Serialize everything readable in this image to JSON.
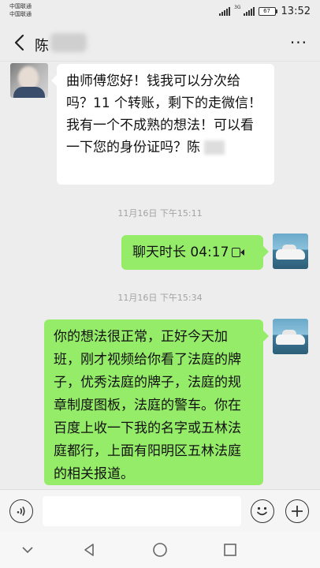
{
  "status_bar": {
    "carrier_1": "中国联通",
    "carrier_2": "中国联通",
    "network_label": "3G",
    "battery": "67",
    "time": "13:52"
  },
  "header": {
    "title": "陈",
    "more_label": "···"
  },
  "messages": [
    {
      "side": "left",
      "text": "曲师傅您好！钱我可以分次给吗？11 个转账，剩下的走微信！我有一个不成熟的想法！可以看一下您的身份证吗？陈"
    },
    {
      "timestamp": "11月16日 下午15:11"
    },
    {
      "side": "right",
      "type": "call",
      "text": "聊天时长 04:17"
    },
    {
      "timestamp": "11月16日 下午15:34"
    },
    {
      "side": "right",
      "text": "你的想法很正常，正好今天加班，刚才视频给你看了法庭的牌子，优秀法庭的牌子，法庭的规章制度图板，法庭的警车。你在百度上收一下我的名字或五林法庭都行，上面有阳明区五林法庭的相关报道。"
    }
  ],
  "input_bar": {
    "value": ""
  },
  "icons": {
    "back": "back-arrow-icon",
    "voice": "voice-icon",
    "emoji": "emoji-icon",
    "plus": "plus-icon",
    "call": "video-call-icon"
  }
}
